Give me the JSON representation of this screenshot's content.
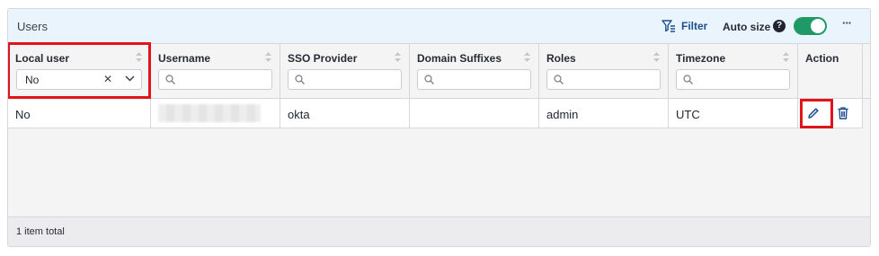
{
  "panel": {
    "title": "Users"
  },
  "toolbar": {
    "filter_label": "Filter",
    "filter_icon": "filter-icon",
    "autosize_label": "Auto size",
    "help_icon_text": "?",
    "autosize_enabled": true,
    "more_label": "···"
  },
  "columns": [
    {
      "label": "Local user",
      "filter_type": "select",
      "filter_value": "No"
    },
    {
      "label": "Username",
      "filter_type": "search",
      "placeholder": ""
    },
    {
      "label": "SSO Provider",
      "filter_type": "search",
      "placeholder": ""
    },
    {
      "label": "Domain Suffixes",
      "filter_type": "search",
      "placeholder": ""
    },
    {
      "label": "Roles",
      "filter_type": "search",
      "placeholder": ""
    },
    {
      "label": "Timezone",
      "filter_type": "search",
      "placeholder": ""
    },
    {
      "label": "Action",
      "filter_type": "none"
    }
  ],
  "rows": [
    {
      "local_user": "No",
      "username": "",
      "username_redacted": true,
      "sso_provider": "okta",
      "domain_suffixes": "",
      "roles": "admin",
      "timezone": "UTC",
      "actions": [
        "edit-icon",
        "trash-icon"
      ]
    }
  ],
  "footer": {
    "total_text": "1 item total"
  },
  "colors": {
    "accent": "#1f4f8f",
    "toggle_on": "#1f9a66",
    "highlight": "#e0141a",
    "toolbar_bg": "#eaf4fd"
  }
}
